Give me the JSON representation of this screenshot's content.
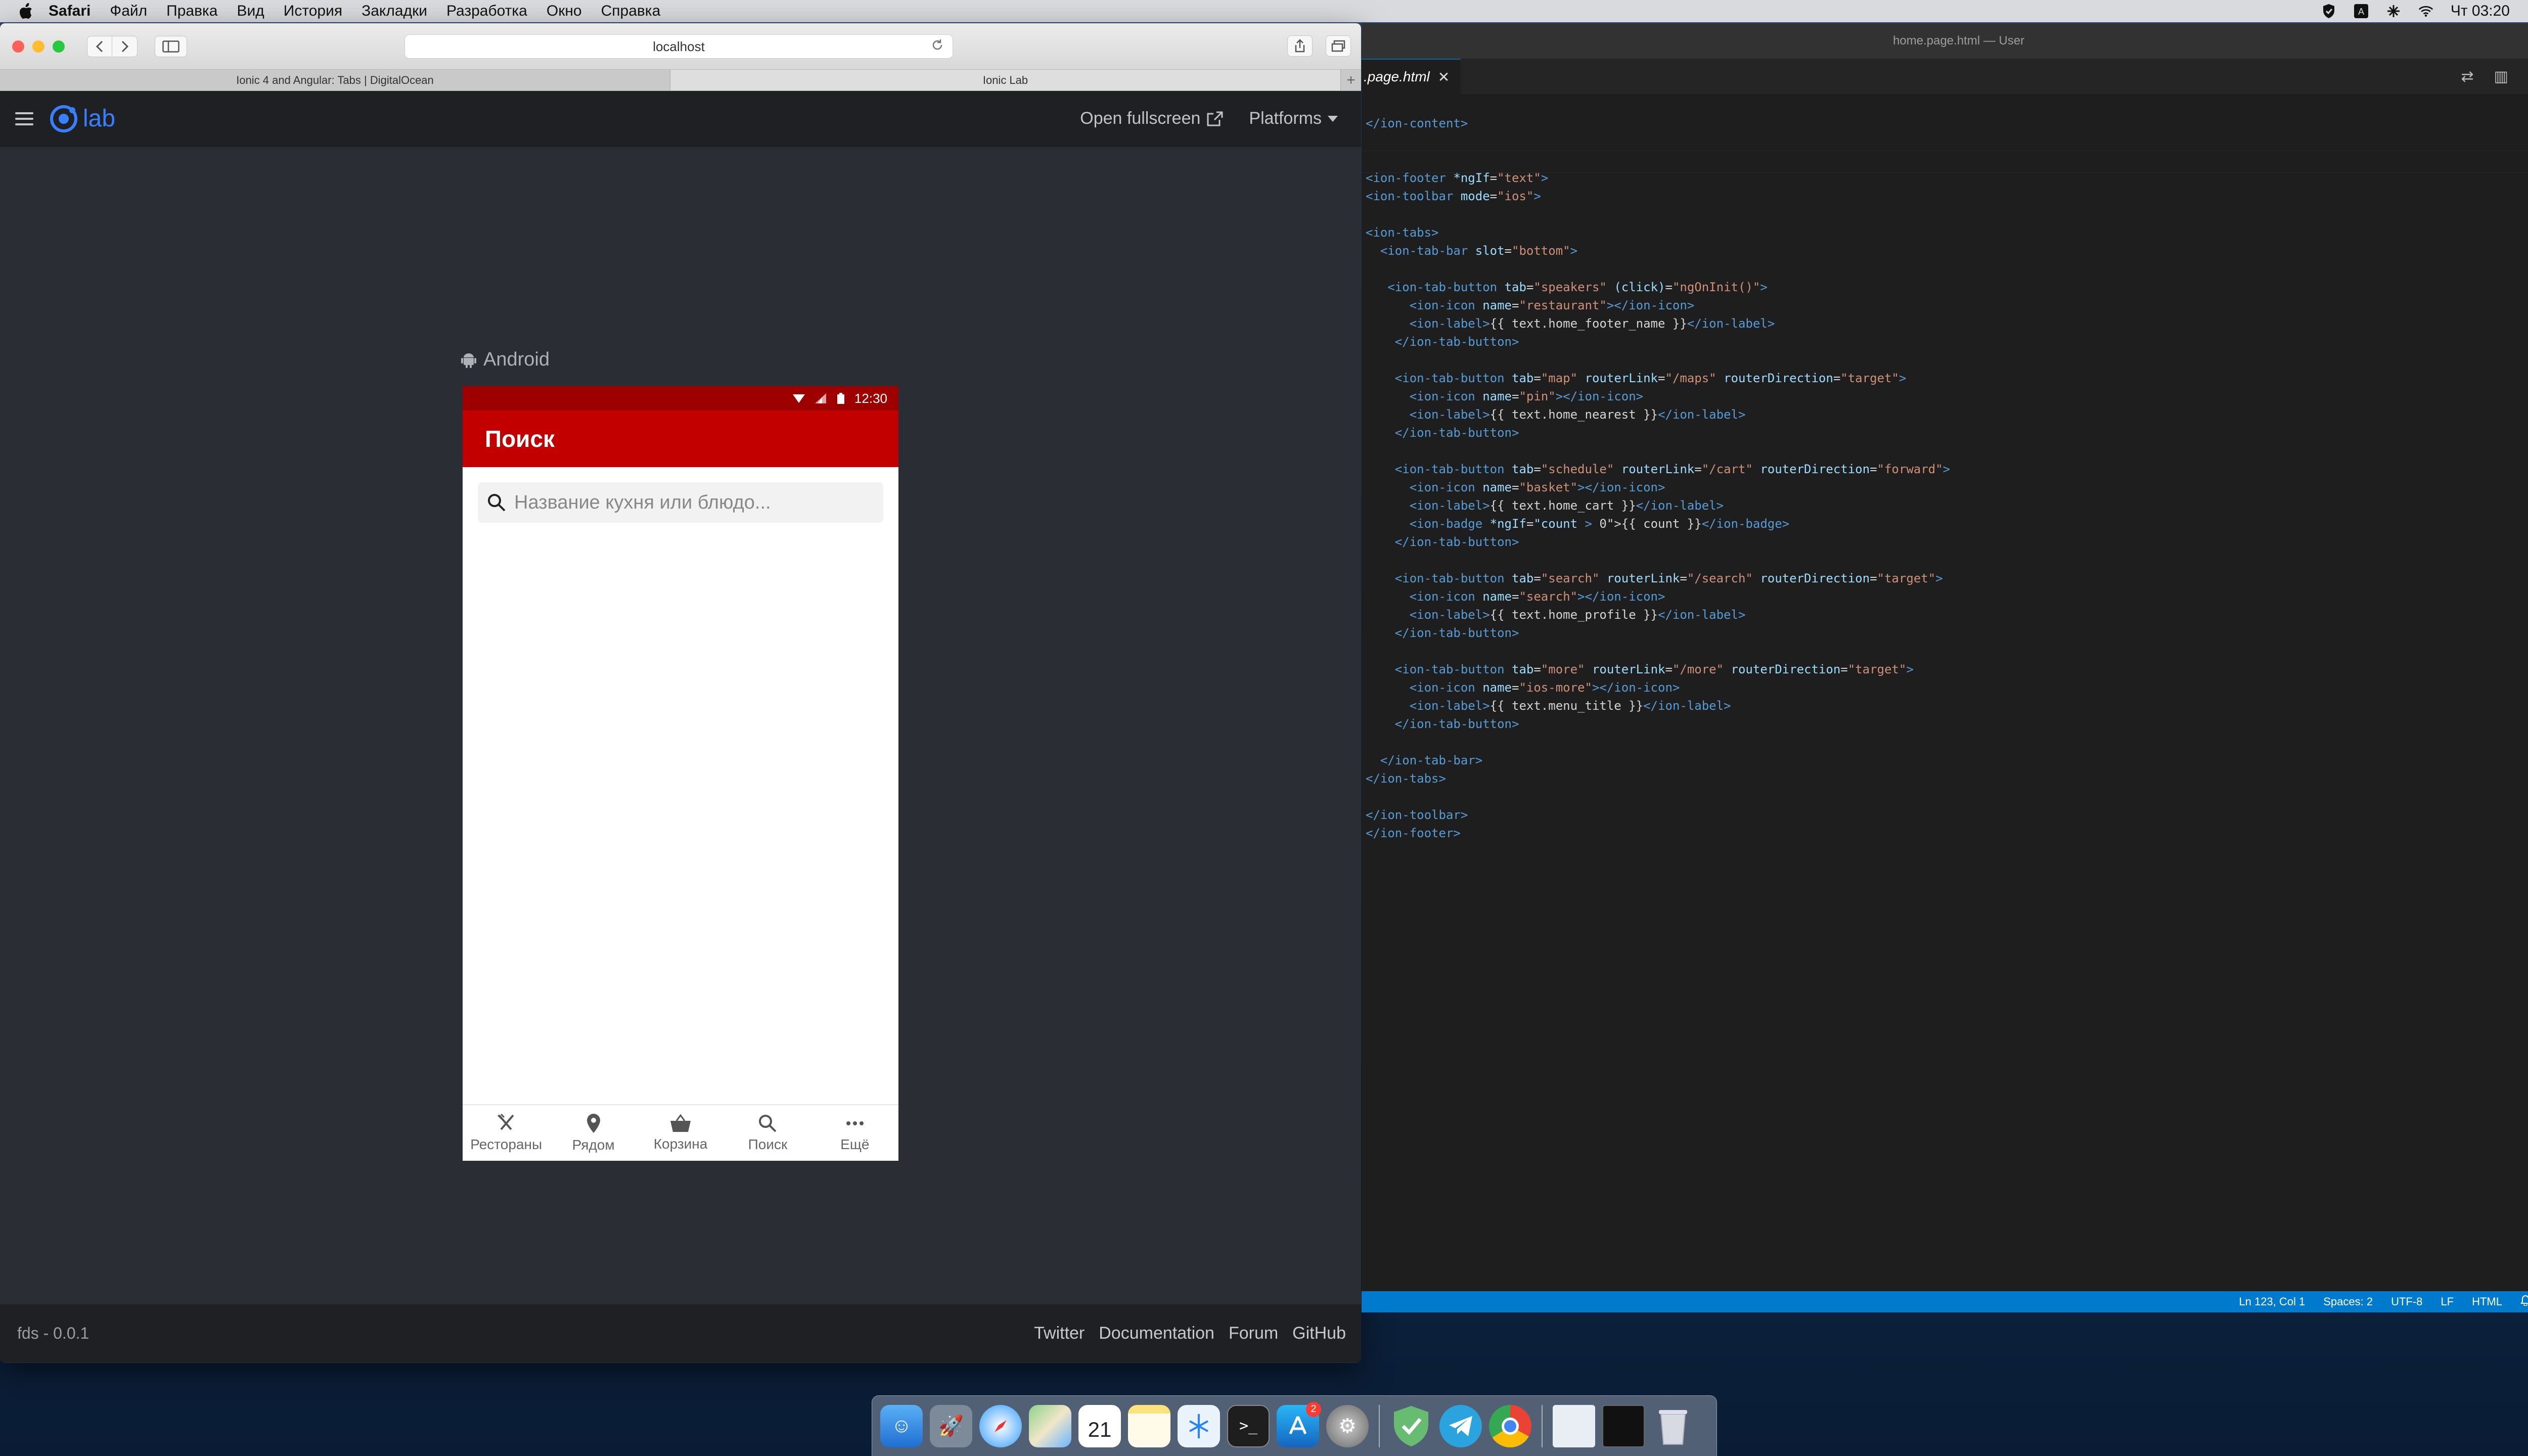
{
  "menubar": {
    "items": [
      "Safari",
      "Файл",
      "Правка",
      "Вид",
      "История",
      "Закладки",
      "Разработка",
      "Окно",
      "Справка"
    ],
    "clock": "Чт 03:20"
  },
  "safari": {
    "url": "localhost",
    "tabs": [
      "Ionic 4 and Angular: Tabs | DigitalOcean",
      "Ionic Lab"
    ]
  },
  "lab": {
    "logo_text": "lab",
    "open_fullscreen": "Open fullscreen",
    "platforms": "Platforms",
    "platform_label": "Android",
    "version": "fds - 0.0.1",
    "footer_links": [
      "Twitter",
      "Documentation",
      "Forum",
      "GitHub"
    ]
  },
  "phone": {
    "time": "12:30",
    "title": "Поиск",
    "search_placeholder": "Название кухня или блюдо...",
    "tabs": [
      {
        "icon": "restaurant-icon",
        "label": "Рестораны"
      },
      {
        "icon": "pin-icon",
        "label": "Рядом"
      },
      {
        "icon": "basket-icon",
        "label": "Корзина"
      },
      {
        "icon": "search-icon",
        "label": "Поиск"
      },
      {
        "icon": "more-icon",
        "label": "Ещё"
      }
    ]
  },
  "vscode": {
    "window_title": "home.page.html — User",
    "tab_name": ".page.html",
    "code_lines": [
      "</ion-content>",
      "",
      "",
      "<ion-footer *ngIf=\"text\">",
      "<ion-toolbar mode=\"ios\">",
      "",
      "<ion-tabs>",
      "  <ion-tab-bar slot=\"bottom\">",
      "",
      "   <ion-tab-button tab=\"speakers\" (click)=\"ngOnInit()\">",
      "      <ion-icon name=\"restaurant\"></ion-icon>",
      "      <ion-label>{{ text.home_footer_name }}</ion-label>",
      "    </ion-tab-button>",
      "",
      "    <ion-tab-button tab=\"map\" routerLink=\"/maps\" routerDirection=\"target\">",
      "      <ion-icon name=\"pin\"></ion-icon>",
      "      <ion-label>{{ text.home_nearest }}</ion-label>",
      "    </ion-tab-button>",
      "",
      "    <ion-tab-button tab=\"schedule\" routerLink=\"/cart\" routerDirection=\"forward\">",
      "      <ion-icon name=\"basket\"></ion-icon>",
      "      <ion-label>{{ text.home_cart }}</ion-label>",
      "      <ion-badge *ngIf=\"count > 0\">{{ count }}</ion-badge>",
      "    </ion-tab-button>",
      "",
      "    <ion-tab-button tab=\"search\" routerLink=\"/search\" routerDirection=\"target\">",
      "      <ion-icon name=\"search\"></ion-icon>",
      "      <ion-label>{{ text.home_profile }}</ion-label>",
      "    </ion-tab-button>",
      "",
      "    <ion-tab-button tab=\"more\" routerLink=\"/more\" routerDirection=\"target\">",
      "      <ion-icon name=\"ios-more\"></ion-icon>",
      "      <ion-label>{{ text.menu_title }}</ion-label>",
      "    </ion-tab-button>",
      "",
      "  </ion-tab-bar>",
      "</ion-tabs>",
      "",
      "</ion-toolbar>",
      "</ion-footer>"
    ],
    "status": [
      "Ln 123, Col 1",
      "Spaces: 2",
      "UTF-8",
      "LF",
      "HTML"
    ]
  },
  "dock": {
    "calendar_day": "21",
    "appstore_badge": "2",
    "apps": [
      "finder-icon",
      "launchpad-icon",
      "safari-icon",
      "maps-icon",
      "calendar-icon",
      "notes-icon",
      "sourcetree-icon",
      "terminal-icon",
      "appstore-icon",
      "system-preferences-icon",
      "adguard-icon",
      "telegram-icon",
      "chrome-icon",
      "preview-icon",
      "terminal-window-icon",
      "trash-icon"
    ]
  },
  "colors": {
    "ionic_red": "#c20000",
    "ionic_blue": "#3880ff",
    "vscode_status": "#007acc"
  }
}
